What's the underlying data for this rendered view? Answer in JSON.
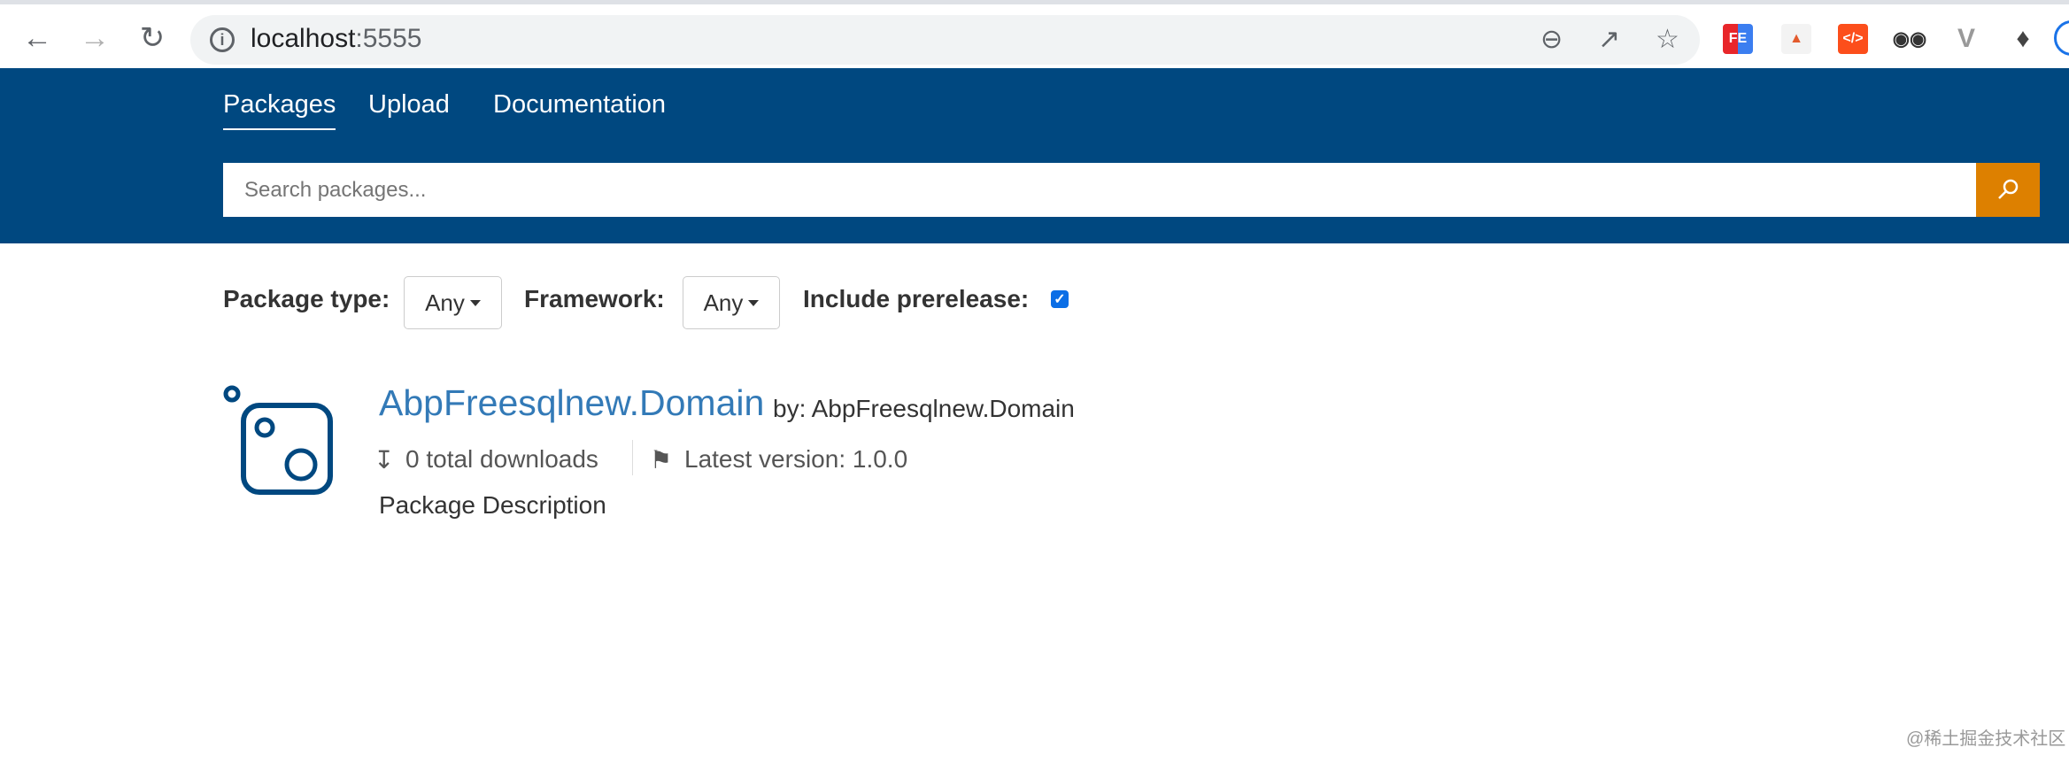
{
  "browser": {
    "url_host": "localhost",
    "url_port": ":5555",
    "icons": [
      "back-icon",
      "forward-icon",
      "reload-icon",
      "info-icon",
      "zoom-out-icon",
      "share-icon",
      "star-icon",
      "extensions-icon"
    ],
    "extensions": [
      {
        "label": "FE",
        "color": "#e8262a"
      },
      {
        "label": "",
        "color": "#f3f3f3"
      },
      {
        "label": "</>",
        "color": "#fc4e1b"
      }
    ]
  },
  "nav": {
    "items": [
      {
        "label": "Packages",
        "active": true
      },
      {
        "label": "Upload"
      },
      {
        "label": "Documentation"
      }
    ],
    "color": "#004880"
  },
  "search": {
    "placeholder": "Search packages...",
    "button_color": "#dd8000"
  },
  "filters": {
    "package_type_label": "Package type:",
    "package_type_value": "Any",
    "framework_label": "Framework:",
    "framework_value": "Any",
    "prerelease_label": "Include prerelease:",
    "prerelease_checked": true
  },
  "package": {
    "title": "AbpFreesqlnew.Domain",
    "author": "by: AbpFreesqlnew.Domain",
    "downloads": "0 total downloads",
    "latest_version": "Latest version: 1.0.0",
    "description": "Package Description"
  },
  "watermark": "@稀土掘金技术社区"
}
